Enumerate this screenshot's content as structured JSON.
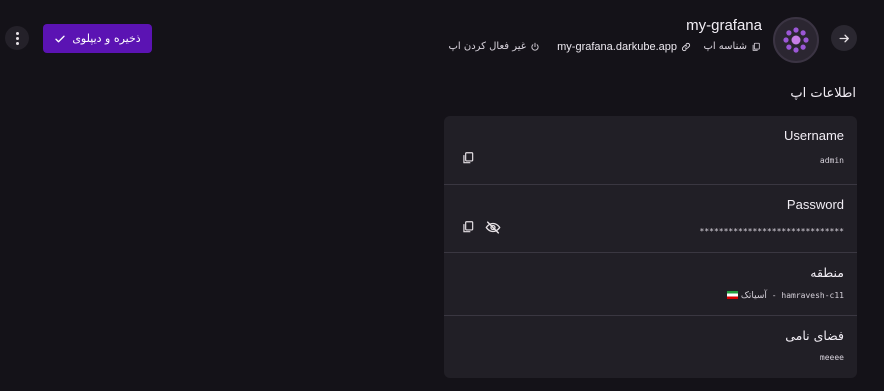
{
  "toolbar": {
    "save_label": "ذخیره و دیپلوی",
    "icons": {
      "menu": "more-vert-icon",
      "save": "check-icon"
    },
    "accent_color": "#5b13b3"
  },
  "header": {
    "app_name": "my-grafana",
    "app_id_label": "شناسه اپ",
    "domain": "my-grafana.darkube.app",
    "disable_label": "غیر فعال کردن اپ",
    "icons": {
      "back": "arrow-right-icon",
      "avatar": "grafana-logo-icon",
      "copy": "copy-icon",
      "link": "link-icon",
      "power": "power-icon"
    }
  },
  "info": {
    "title": "اطلاعات اپ",
    "rows": [
      {
        "label": "Username",
        "value": "admin"
      },
      {
        "label": "Password",
        "value": "******************************"
      },
      {
        "label": "منطقه",
        "value_latin": "hamravesh-c11",
        "value_separator": " - ",
        "value_fa": "آسیاتک"
      },
      {
        "label": "فضای نامی",
        "value": "meeee"
      }
    ],
    "icons": {
      "copy": "copy-icon",
      "visibility": "visibility-off-icon",
      "flag": "iran-flag-icon"
    }
  }
}
